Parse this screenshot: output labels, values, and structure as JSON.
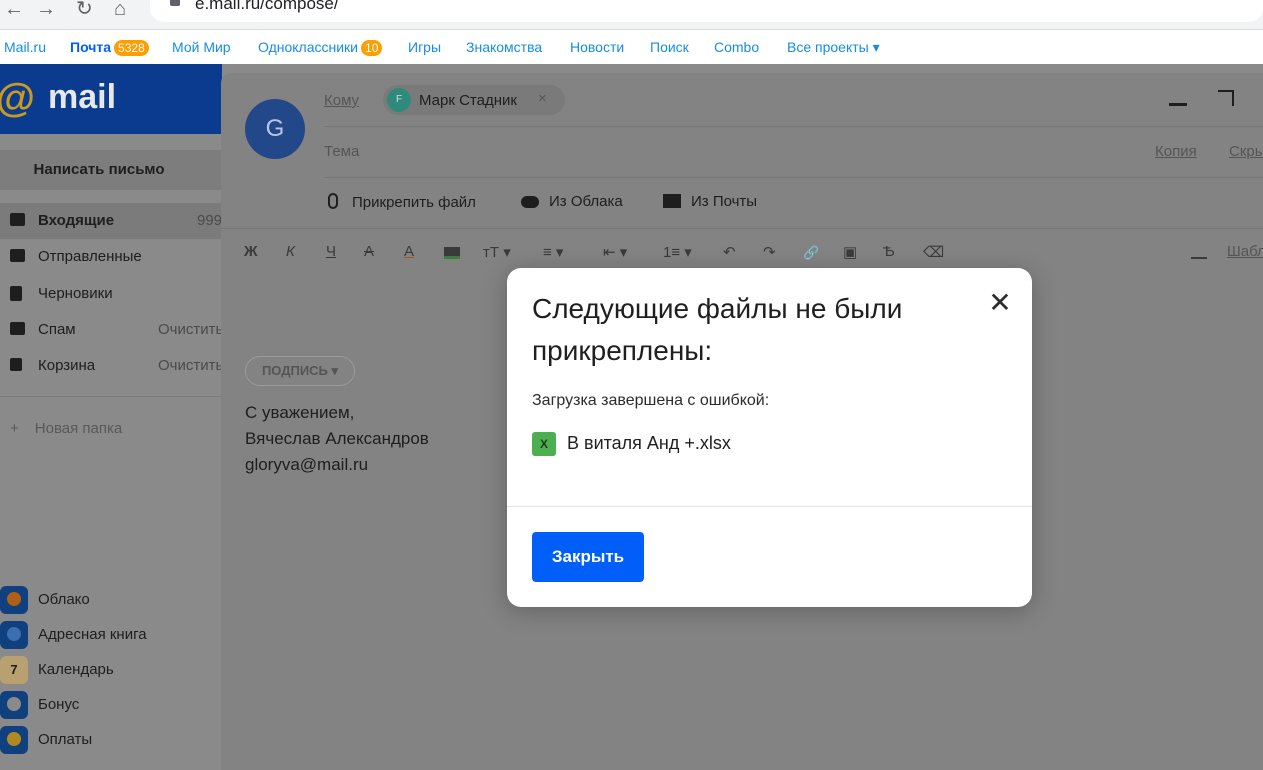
{
  "browser": {
    "url": "e.mail.ru/compose/",
    "back_glyph": "←",
    "forward_glyph": "→",
    "reload_glyph": "↻",
    "home_glyph": "⌂"
  },
  "portal": {
    "links": {
      "mailru": "Mail.ru",
      "pochta": "Почта",
      "pochta_badge": "5328",
      "moy_mir": "Мой Мир",
      "odnoklassniki": "Одноклассники",
      "ok_badge": "10",
      "igry": "Игры",
      "znakomstva": "Знакомства",
      "novosti": "Новости",
      "poisk": "Поиск",
      "combo": "Combo",
      "vse_proekty": "Все проекты ▾"
    }
  },
  "sidebar": {
    "logo_text": "mail",
    "logo_at": "@",
    "compose_label": "Написать письмо",
    "folders": {
      "inbox": {
        "label": "Входящие",
        "count": "999"
      },
      "sent": {
        "label": "Отправленные"
      },
      "drafts": {
        "label": "Черновики"
      },
      "spam": {
        "label": "Спам",
        "action": "Очистить"
      },
      "trash": {
        "label": "Корзина",
        "action": "Очистить"
      }
    },
    "new_folder_plus": "+",
    "new_folder": "Новая папка",
    "services": {
      "cloud": "Облако",
      "contacts": "Адресная книга",
      "calendar": "Календарь",
      "calendar_day": "7",
      "bonus": "Бонус",
      "payments": "Оплаты"
    }
  },
  "compose": {
    "avatar_letter": "G",
    "to_label": "Кому",
    "recipient_initial": "F",
    "recipient_name": "Марк Стадник",
    "remove_glyph": "×",
    "subject_placeholder": "Тема",
    "copy_label": "Копия",
    "hide_label": "Скры",
    "attach_file": "Прикрепить файл",
    "from_cloud": "Из Облака",
    "from_mail": "Из Почты",
    "template_label": "Шабл",
    "toolbar": {
      "bold": "Ж",
      "italic": "К",
      "underline": "Ч",
      "strike": "А",
      "text_color": "А",
      "font_size": "тТ ▾",
      "align": "≡ ▾",
      "indent": "⇤ ▾",
      "list": "1≡ ▾",
      "undo": "↶",
      "redo": "↷",
      "link": "🔗",
      "image": "▣",
      "translit": "Ѣ",
      "clear": "⌫"
    },
    "signature_chip": "ПОДПИСЬ ▾",
    "signature_lines": {
      "line1": "С уважением,",
      "line2": "Вячеслав Александров",
      "line3": "gloryva@mail.ru"
    }
  },
  "modal": {
    "title": "Следующие файлы не были прикреплены:",
    "close_glyph": "✕",
    "message": "Загрузка завершена с ошибкой:",
    "file_icon_letter": "X",
    "file_name": "В виталя Анд +.xlsx",
    "button_label": "Закрыть"
  },
  "colors": {
    "primary_button": "#005ff9",
    "portal_link": "#168de2",
    "badge": "#ff9e00",
    "xlsx": "#4caf50"
  }
}
